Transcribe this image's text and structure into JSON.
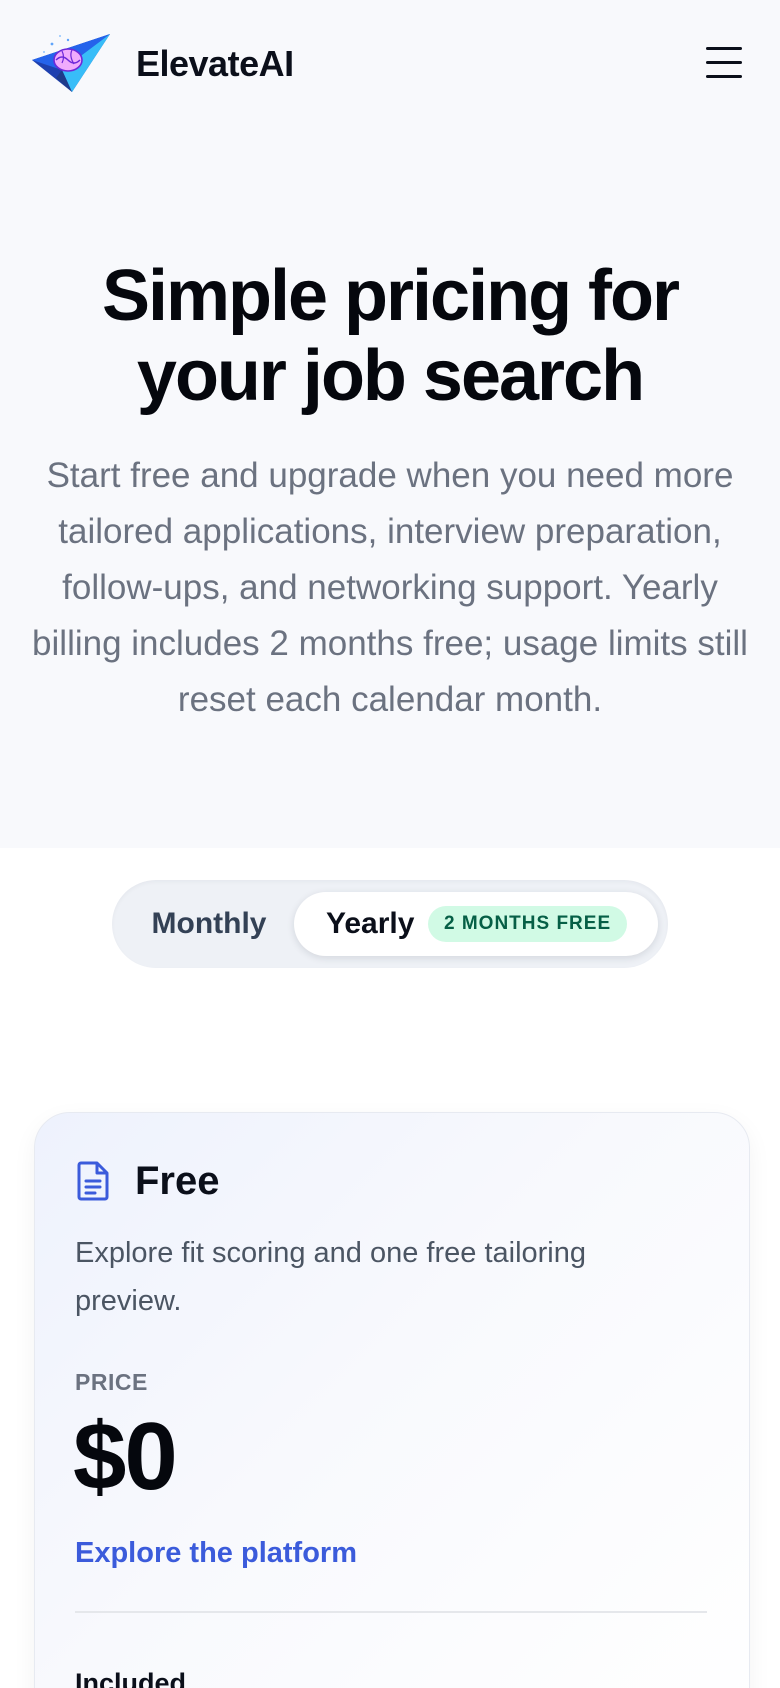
{
  "header": {
    "brand_name": "ElevateAI",
    "logo_icon": "brain-paper-plane-icon",
    "menu_icon": "hamburger-menu-icon"
  },
  "hero": {
    "title": "Simple pricing for your job search",
    "subtitle": "Start free and upgrade when you need more tailored applications, interview preparation, follow-ups, and networking support. Yearly billing includes 2 months free; usage limits still reset each calendar month."
  },
  "billing_toggle": {
    "monthly_label": "Monthly",
    "yearly_label": "Yearly",
    "yearly_badge": "2 MONTHS FREE",
    "selected": "Yearly"
  },
  "plans": [
    {
      "icon": "document-icon",
      "name": "Free",
      "description": "Explore fit scoring and one free tailoring preview.",
      "price_label": "PRICE",
      "price": "$0",
      "cta": "Explore the platform",
      "included_heading": "Included"
    }
  ],
  "colors": {
    "accent": "#3b5bdb",
    "hero_background": "#f8f9fc",
    "badge_background": "#d1fae5",
    "badge_text": "#065f46",
    "heading_text": "#05070d",
    "muted_text": "#6b7280"
  }
}
